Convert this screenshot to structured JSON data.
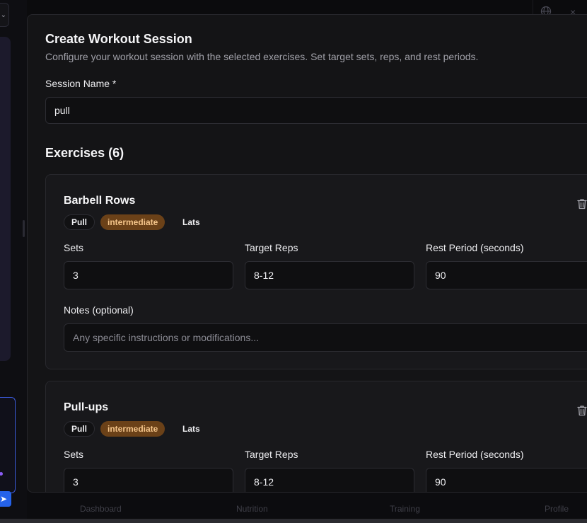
{
  "background": {
    "nav": [
      "Dashboard",
      "Nutrition",
      "Training",
      "Profile"
    ],
    "select_chevron": "⌄",
    "send_icon": "➤",
    "globe_icon": "globe-icon",
    "close_icon": "×"
  },
  "modal": {
    "title": "Create Workout Session",
    "description": "Configure your workout session with the selected exercises. Set target sets, reps, and rest periods.",
    "session_name_label": "Session Name *",
    "session_name_value": "pull",
    "exercises_title": "Exercises (6)",
    "exercises": [
      {
        "name": "Barbell Rows",
        "category": "Pull",
        "level": "intermediate",
        "muscle": "Lats",
        "sets_label": "Sets",
        "sets": "3",
        "reps_label": "Target Reps",
        "reps": "8-12",
        "rest_label": "Rest Period (seconds)",
        "rest": "90",
        "notes_label": "Notes (optional)",
        "notes_placeholder": "Any specific instructions or modifications..."
      },
      {
        "name": "Pull-ups",
        "category": "Pull",
        "level": "intermediate",
        "muscle": "Lats",
        "sets_label": "Sets",
        "sets": "3",
        "reps_label": "Target Reps",
        "reps": "8-12",
        "rest_label": "Rest Period (seconds)",
        "rest": "90"
      }
    ]
  },
  "colors": {
    "level_badge_bg": "#6b4118",
    "level_badge_text": "#f5c58a",
    "accent_blue": "#2563eb"
  }
}
